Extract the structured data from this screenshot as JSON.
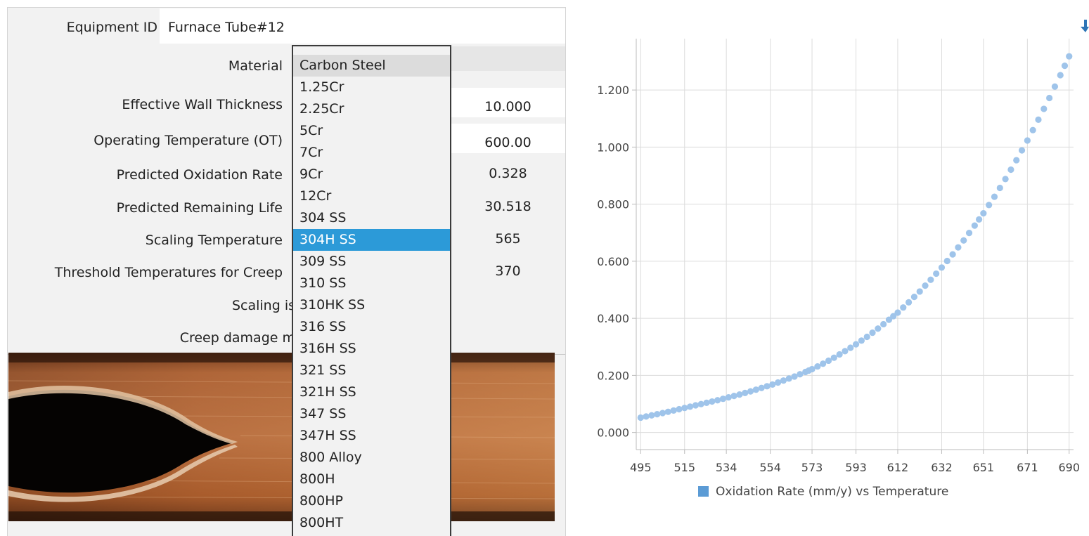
{
  "form": {
    "equipment_id_label": "Equipment ID",
    "equipment_id_value": "Furnace Tube#12",
    "material_label": "Material",
    "rows": [
      {
        "label": "Effective Wall Thickness",
        "value": "10.000"
      },
      {
        "label": "Operating Temperature (OT)",
        "value": "600.00"
      },
      {
        "label": "Predicted Oxidation Rate",
        "value": "0.328"
      },
      {
        "label": "Predicted Remaining Life",
        "value": "30.518"
      },
      {
        "label": "Scaling Temperature",
        "value": "565"
      },
      {
        "label": "Threshold Temperatures for Creep",
        "value": "370"
      }
    ],
    "scaling_label": "Scaling is",
    "creep_label": "Creep damage m"
  },
  "material_dropdown": {
    "current": "Carbon Steel",
    "highlighted": "304H SS",
    "options": [
      "Carbon Steel",
      "1.25Cr",
      "2.25Cr",
      "5Cr",
      "7Cr",
      "9Cr",
      "12Cr",
      "304 SS",
      "304H SS",
      "309 SS",
      "310 SS",
      "310HK SS",
      "316 SS",
      "316H SS",
      "321 SS",
      "321H SS",
      "347 SS",
      "347H SS",
      "800 Alloy",
      "800H",
      "800HP",
      "800HT"
    ]
  },
  "image": {
    "icon": "oxidized-tube-photo"
  },
  "chart_data": {
    "type": "scatter",
    "title": "",
    "xlabel": "",
    "ylabel": "",
    "x_ticks": [
      "495",
      "515",
      "534",
      "554",
      "573",
      "593",
      "612",
      "632",
      "651",
      "671",
      "690"
    ],
    "y_ticks": [
      "0.000",
      "0.200",
      "0.400",
      "0.600",
      "0.800",
      "1.000",
      "1.200"
    ],
    "xlim": [
      493,
      692
    ],
    "ylim": [
      -0.06,
      1.38
    ],
    "series": [
      {
        "name": "Oxidation Rate (mm/y) vs Temperature",
        "color": "#9fc4ea",
        "points": [
          [
            495,
            0.052
          ],
          [
            500,
            0.06
          ],
          [
            505,
            0.068
          ],
          [
            510,
            0.077
          ],
          [
            515,
            0.086
          ],
          [
            520,
            0.095
          ],
          [
            525,
            0.104
          ],
          [
            530,
            0.113
          ],
          [
            535,
            0.123
          ],
          [
            540,
            0.133
          ],
          [
            545,
            0.144
          ],
          [
            550,
            0.156
          ],
          [
            555,
            0.168
          ],
          [
            560,
            0.182
          ],
          [
            565,
            0.196
          ],
          [
            570,
            0.212
          ],
          [
            573,
            0.222
          ],
          [
            578,
            0.241
          ],
          [
            583,
            0.262
          ],
          [
            588,
            0.285
          ],
          [
            593,
            0.309
          ],
          [
            598,
            0.335
          ],
          [
            603,
            0.364
          ],
          [
            608,
            0.395
          ],
          [
            612,
            0.42
          ],
          [
            617,
            0.456
          ],
          [
            622,
            0.494
          ],
          [
            627,
            0.535
          ],
          [
            632,
            0.578
          ],
          [
            637,
            0.624
          ],
          [
            642,
            0.673
          ],
          [
            647,
            0.725
          ],
          [
            651,
            0.768
          ],
          [
            656,
            0.826
          ],
          [
            661,
            0.888
          ],
          [
            666,
            0.954
          ],
          [
            671,
            1.023
          ],
          [
            676,
            1.096
          ],
          [
            681,
            1.172
          ],
          [
            686,
            1.252
          ],
          [
            690,
            1.318
          ]
        ]
      }
    ],
    "legend": "bottom",
    "grid": true
  }
}
